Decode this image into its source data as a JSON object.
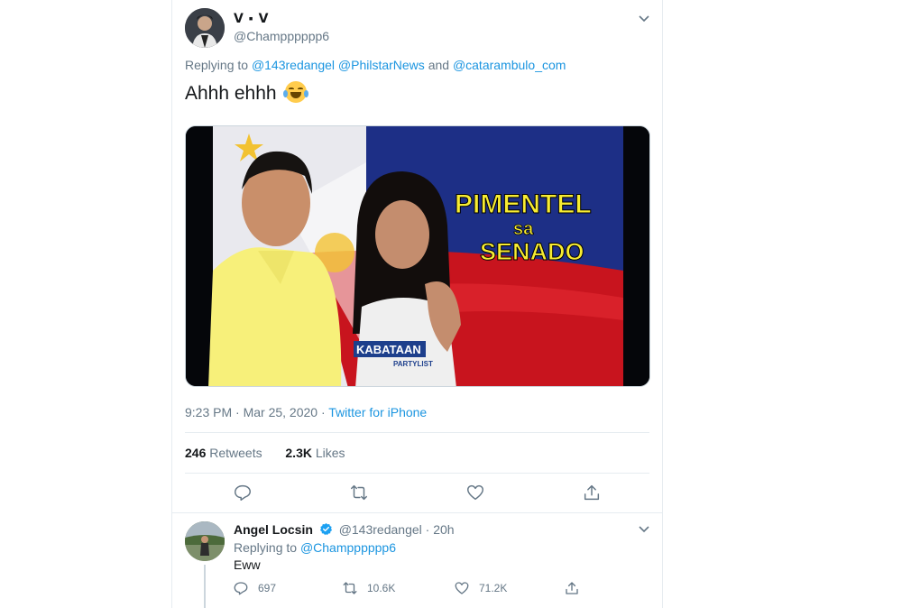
{
  "tweet": {
    "display_name": "ᐯ ▪ ᐯ",
    "handle": "@Champppppp6",
    "replying_prefix": "Replying to",
    "replying_to": [
      "@143redangel",
      "@PhilstarNews"
    ],
    "replying_and": "and",
    "replying_last": "@catarambulo_com",
    "text": "Ahhh ehhh",
    "emoji": "face-with-tears-of-joy",
    "media": {
      "title_line1": "PIMENTEL",
      "title_line2": "sa",
      "title_line3": "SENADO",
      "shirt_text": "KABATAAN",
      "shirt_subtext": "PARTYLIST"
    },
    "timestamp": "9:23 PM · Mar 25, 2020 ·",
    "source": "Twitter for iPhone",
    "retweets_count": "246",
    "retweets_label": "Retweets",
    "likes_count": "2.3K",
    "likes_label": "Likes",
    "icons": [
      "reply-icon",
      "retweet-icon",
      "like-icon",
      "share-icon"
    ]
  },
  "reply": {
    "display_name": "Angel Locsin",
    "handle_time": "@143redangel · 20h",
    "replying_prefix": "Replying to",
    "replying_to": "@Champppppp6",
    "text": "Eww",
    "reply_count": "697",
    "retweet_count": "10.6K",
    "like_count": "71.2K"
  },
  "colors": {
    "link": "#1b95e0",
    "secondary_text": "#657786",
    "divider": "#e6ecf0"
  }
}
